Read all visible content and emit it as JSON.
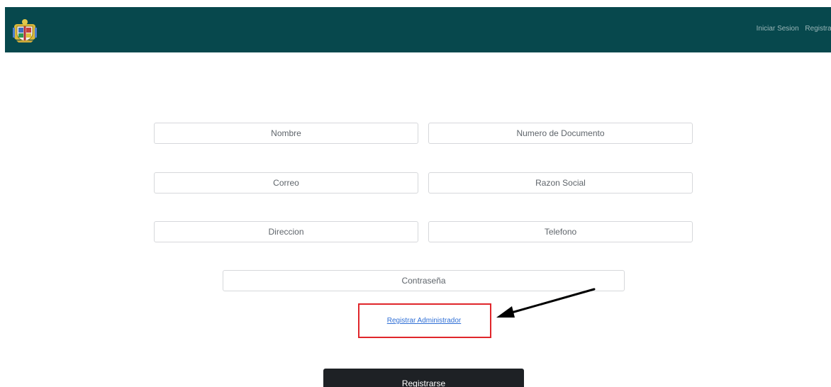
{
  "navbar": {
    "logo_icon": "coat-of-arms-icon",
    "links": [
      "Iniciar Sesion",
      "Registrar"
    ],
    "background": "#07484d"
  },
  "form": {
    "fields": {
      "nombre": "Nombre",
      "numero_documento": "Numero de Documento",
      "correo": "Correo",
      "razon_social": "Razon Social",
      "direccion": "Direccion",
      "telefono": "Telefono",
      "contrasena": "Contraseña"
    },
    "admin_link_label": "Registrar Administrador",
    "submit_label": "Registrarse"
  },
  "annotation": {
    "highlight_color": "#e0262b",
    "arrow_icon": "arrow-icon"
  }
}
